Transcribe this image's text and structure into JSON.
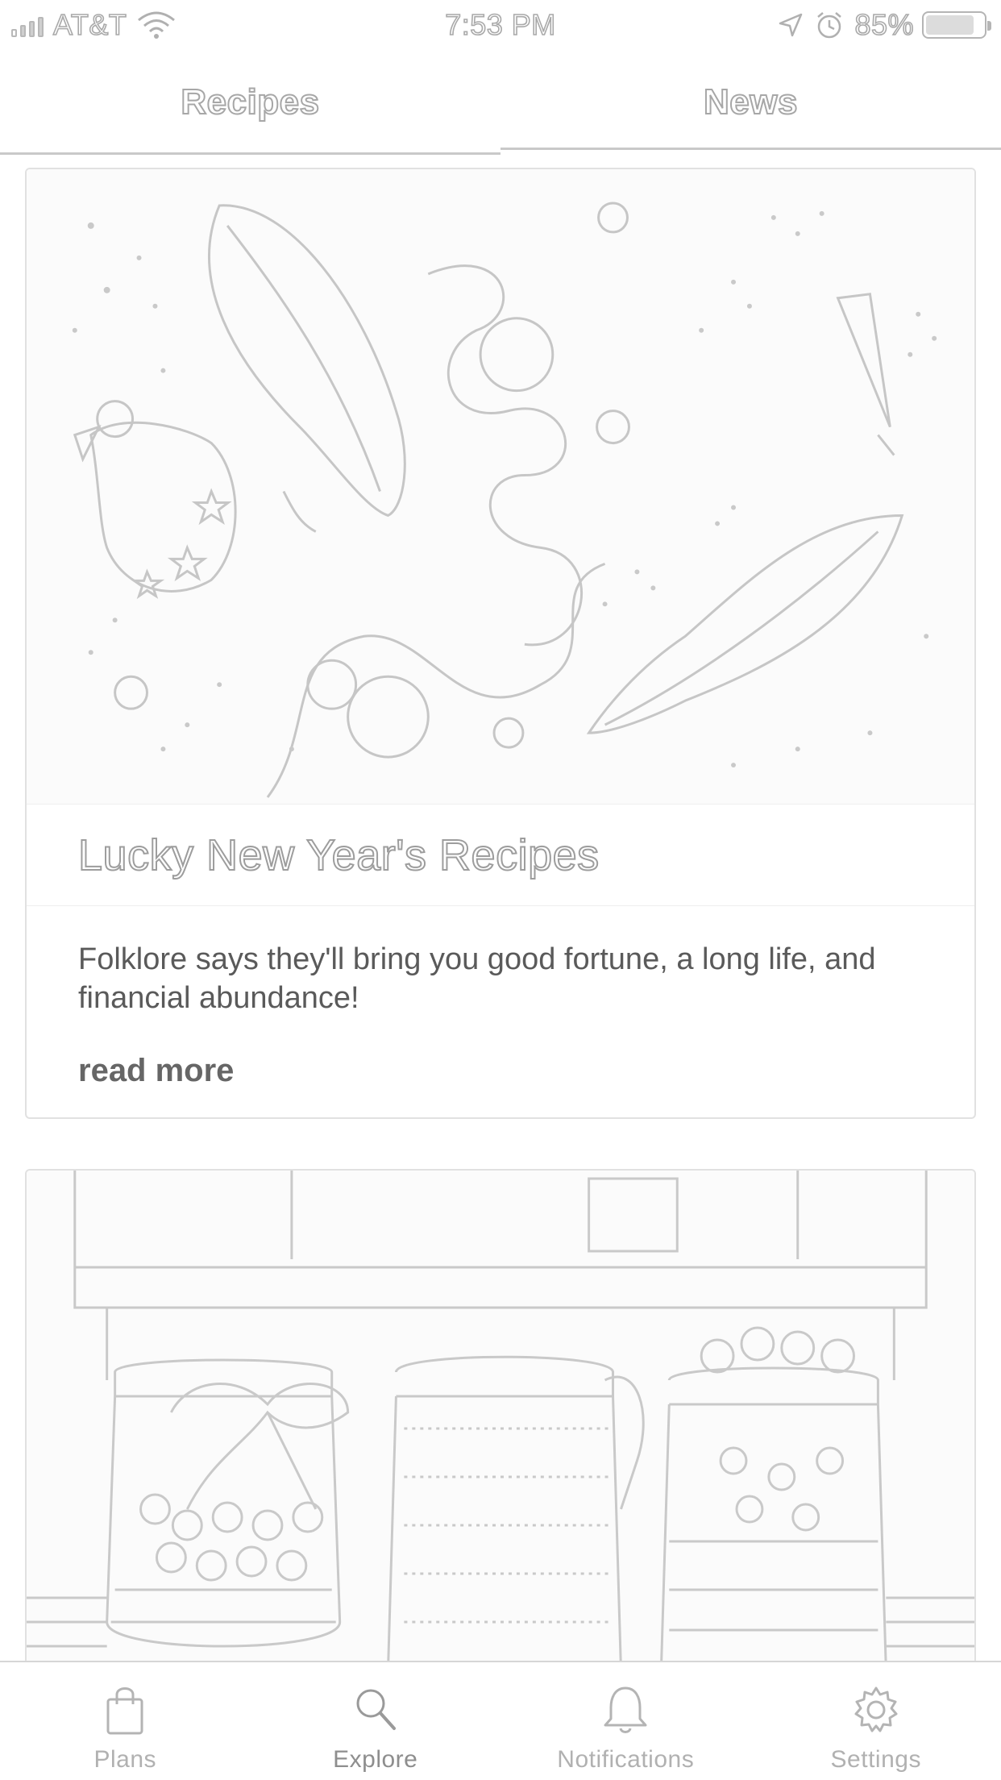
{
  "status_bar": {
    "carrier": "AT&T",
    "time": "7:53 PM",
    "battery_percent": "85%",
    "battery_level": 0.85,
    "icons": [
      "signal-icon",
      "wifi-icon",
      "location-arrow-icon",
      "alarm-icon",
      "battery-icon"
    ]
  },
  "top_tabs": [
    {
      "label": "Recipes",
      "selected": false
    },
    {
      "label": "News",
      "selected": true
    }
  ],
  "cards": [
    {
      "title": "Lucky New Year's Recipes",
      "description": "Folklore says they'll bring you good fortune, a long life, and financial abundance!",
      "read_more": "read more"
    }
  ],
  "bottom_nav": [
    {
      "label": "Plans",
      "icon": "shopping-bag-icon",
      "active": false
    },
    {
      "label": "Explore",
      "icon": "search-icon",
      "active": true
    },
    {
      "label": "Notifications",
      "icon": "bell-icon",
      "active": false
    },
    {
      "label": "Settings",
      "icon": "gear-icon",
      "active": false
    }
  ],
  "colors": {
    "background": "#ffffff",
    "outline_text": "#a7a7a7",
    "inactive_nav": "#b1b1b1",
    "active_nav": "#8e8e8e",
    "divider": "#d6d6d6"
  }
}
